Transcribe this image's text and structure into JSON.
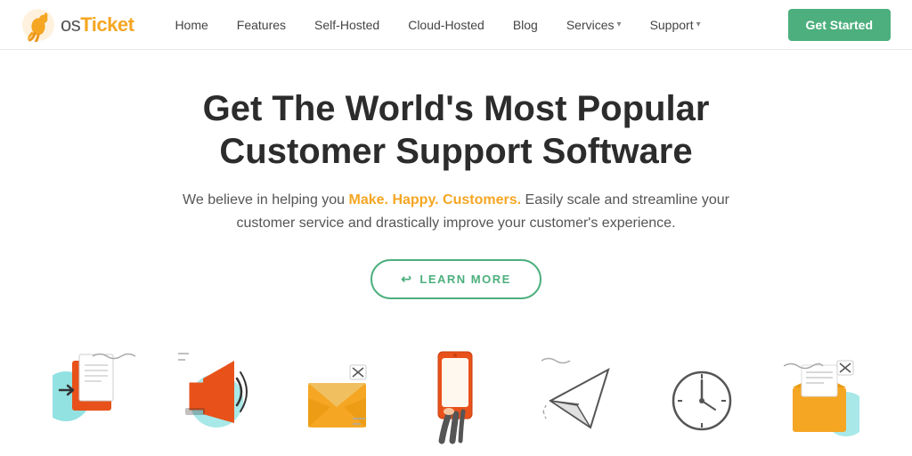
{
  "brand": {
    "logo_prefix": "os",
    "logo_highlight": "Ticket",
    "tagline": "osTicket"
  },
  "navbar": {
    "links": [
      {
        "id": "home",
        "label": "Home",
        "has_dropdown": false
      },
      {
        "id": "features",
        "label": "Features",
        "has_dropdown": false
      },
      {
        "id": "self-hosted",
        "label": "Self-Hosted",
        "has_dropdown": false
      },
      {
        "id": "cloud-hosted",
        "label": "Cloud-Hosted",
        "has_dropdown": false
      },
      {
        "id": "blog",
        "label": "Blog",
        "has_dropdown": false
      },
      {
        "id": "services",
        "label": "Services",
        "has_dropdown": true
      },
      {
        "id": "support",
        "label": "Support",
        "has_dropdown": true
      }
    ],
    "cta_button": "Get Started"
  },
  "hero": {
    "heading_line1": "Get The World's Most Popular",
    "heading_line2": "Customer Support Software",
    "description_before": "We believe in helping you ",
    "description_highlight": "Make. Happy. Customers.",
    "description_after": " Easily scale and streamline your customer service and drastically improve your customer's experience.",
    "cta_button": "LEARN MORE"
  },
  "colors": {
    "green": "#4caf7d",
    "orange": "#f5a623",
    "teal": "#26c6c6",
    "red_orange": "#e8521a",
    "dark_text": "#2c2c2c",
    "body_text": "#555555"
  }
}
